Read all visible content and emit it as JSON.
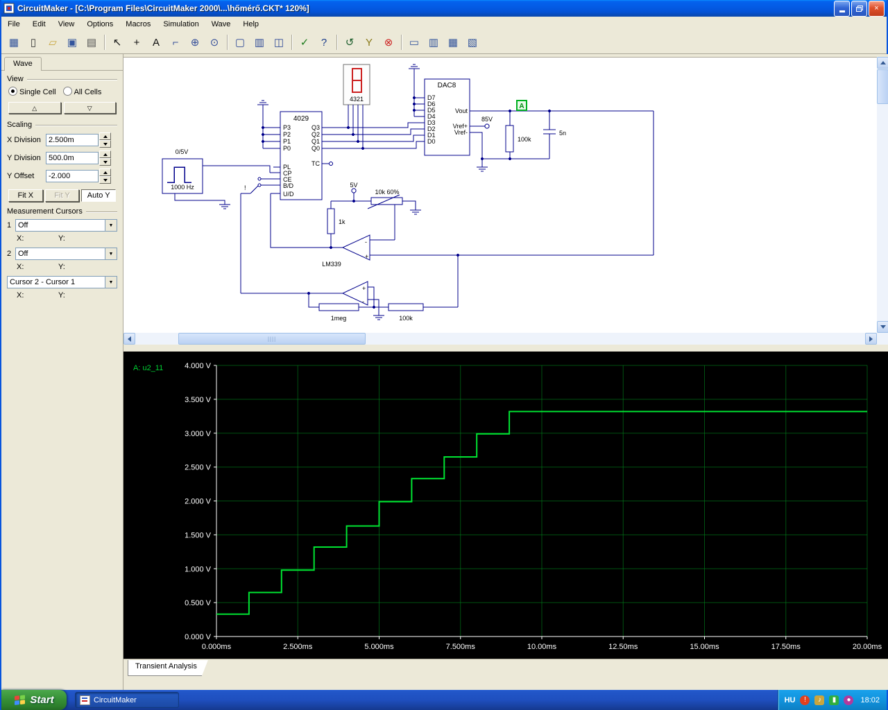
{
  "window": {
    "title": "CircuitMaker - [C:\\Program Files\\CircuitMaker 2000\\...\\hőmérő.CKT* 120%]"
  },
  "menu": {
    "items": [
      "File",
      "Edit",
      "View",
      "Options",
      "Macros",
      "Simulation",
      "Wave",
      "Help"
    ]
  },
  "toolbar": {
    "buttons": [
      {
        "name": "board-icon",
        "glyph": "▦",
        "color": "#33549c"
      },
      {
        "name": "new-file-icon",
        "glyph": "▯",
        "color": "#333333"
      },
      {
        "name": "open-folder-icon",
        "glyph": "▱",
        "color": "#c8a53d"
      },
      {
        "name": "save-icon",
        "glyph": "▣",
        "color": "#33549c"
      },
      {
        "name": "print-icon",
        "glyph": "▤",
        "color": "#555555"
      },
      "|",
      {
        "name": "cursor-arrow-icon",
        "glyph": "↖",
        "color": "#111111"
      },
      {
        "name": "plus-tool-icon",
        "glyph": "+",
        "color": "#111111"
      },
      {
        "name": "text-tool-icon",
        "glyph": "A",
        "color": "#111111"
      },
      {
        "name": "wire-tool-icon",
        "glyph": "⌐",
        "color": "#334d99"
      },
      {
        "name": "zoom-in-icon",
        "glyph": "⊕",
        "color": "#334d99"
      },
      {
        "name": "magnifier-icon",
        "glyph": "⊙",
        "color": "#334d99"
      },
      "|",
      {
        "name": "zoom-page-icon",
        "glyph": "▢",
        "color": "#334d99"
      },
      {
        "name": "sheet-icon",
        "glyph": "▥",
        "color": "#334d99"
      },
      {
        "name": "split-view-icon",
        "glyph": "◫",
        "color": "#334d99"
      },
      "|",
      {
        "name": "run-simulation-icon",
        "glyph": "✓",
        "color": "#1a7a1a"
      },
      {
        "name": "help-icon",
        "glyph": "?",
        "color": "#1a3c8c"
      },
      "|",
      {
        "name": "reset-icon",
        "glyph": "↺",
        "color": "#1a5c2a"
      },
      {
        "name": "probe-tool-icon",
        "glyph": "Y",
        "color": "#8a7a1a"
      },
      {
        "name": "stop-icon",
        "glyph": "⊗",
        "color": "#cc2222"
      },
      "|",
      {
        "name": "digital-option-1-icon",
        "glyph": "▭",
        "color": "#33549c"
      },
      {
        "name": "digital-option-2-icon",
        "glyph": "▥",
        "color": "#33549c"
      },
      {
        "name": "digital-option-3-icon",
        "glyph": "▦",
        "color": "#33549c"
      },
      {
        "name": "digital-option-4-icon",
        "glyph": "▧",
        "color": "#33549c"
      }
    ]
  },
  "wave_panel": {
    "tab": "Wave",
    "view": {
      "label": "View",
      "single_cell": "Single Cell",
      "all_cells": "All Cells",
      "up_glyph": "△",
      "down_glyph": "▽"
    },
    "scaling": {
      "label": "Scaling",
      "x_division_label": "X Division",
      "x_division_value": "2.500m",
      "y_division_label": "Y Division",
      "y_division_value": "500.0m",
      "y_offset_label": "Y Offset",
      "y_offset_value": "-2.000",
      "fit_x": "Fit X",
      "fit_y": "Fit Y",
      "auto_y": "Auto Y"
    },
    "cursors": {
      "label": "Measurement Cursors",
      "c1_label": "1",
      "c1_value": "Off",
      "c2_label": "2",
      "c2_value": "Off",
      "diff_value": "Cursor 2 - Cursor 1",
      "x_label": "X:",
      "y_label": "Y:"
    }
  },
  "schematic": {
    "display": {
      "label": "4321"
    },
    "counter": {
      "title": "4029",
      "p3": "P3",
      "p2": "P2",
      "p1": "P1",
      "p0": "P0",
      "pl": "PL",
      "cp": "CP",
      "ce": "CE",
      "bd": "B/D",
      "ud": "U/D",
      "q3": "Q3",
      "q2": "Q2",
      "q1": "Q1",
      "q0": "Q0",
      "tc": "TC"
    },
    "dac": {
      "title": "DAC8",
      "d7": "D7",
      "d6": "D6",
      "d5": "D5",
      "d4": "D4",
      "d3": "D3",
      "d2": "D2",
      "d1": "D1",
      "d0": "D0",
      "vout": "Vout",
      "vrefp": "Vref+",
      "vrefm": "Vref-"
    },
    "source": {
      "amplitude": "0/5V",
      "freq": "1000 Hz"
    },
    "labels": {
      "v85": "85V",
      "r_pullup": "100k",
      "cap": "5n",
      "v5": "5V",
      "pot": "10k  60%",
      "r_in": "1k",
      "comparator": "LM339",
      "r_fb": "1meg",
      "r_out": "100k",
      "probe": "A",
      "excl": "!"
    }
  },
  "waveform": {
    "trace_label": "A: u2_11",
    "tab": "Transient Analysis"
  },
  "chart_data": {
    "type": "line",
    "title": "Transient Analysis",
    "series": [
      {
        "name": "A: u2_11",
        "color": "#00e432",
        "step": true,
        "x": [
          0,
          1,
          2,
          3,
          4,
          5,
          6,
          7,
          8,
          9,
          20
        ],
        "y": [
          0.33,
          0.65,
          0.98,
          1.32,
          1.63,
          1.99,
          2.33,
          2.65,
          2.99,
          3.32,
          3.32
        ]
      }
    ],
    "xlim": [
      0,
      20
    ],
    "ylim": [
      0,
      4
    ],
    "x_ticks": {
      "values": [
        0,
        2.5,
        5,
        7.5,
        10,
        12.5,
        15,
        17.5,
        20
      ],
      "labels": [
        "0.000ms",
        "2.500ms",
        "5.000ms",
        "7.500ms",
        "10.00ms",
        "12.50ms",
        "15.00ms",
        "17.50ms",
        "20.00ms"
      ]
    },
    "y_ticks": {
      "values": [
        4,
        3.5,
        3,
        2.5,
        2,
        1.5,
        1,
        0.5,
        0
      ],
      "labels": [
        "4.000 V",
        "3.500 V",
        "3.000 V",
        "2.500 V",
        "2.000 V",
        "1.500 V",
        "1.000 V",
        "0.500 V",
        "0.000 V"
      ]
    },
    "grid": true,
    "background": "#000000",
    "legend_position": "top-left"
  },
  "taskbar": {
    "start_label": "Start",
    "task_label": "CircuitMaker",
    "language": "HU",
    "time": "18:02"
  }
}
